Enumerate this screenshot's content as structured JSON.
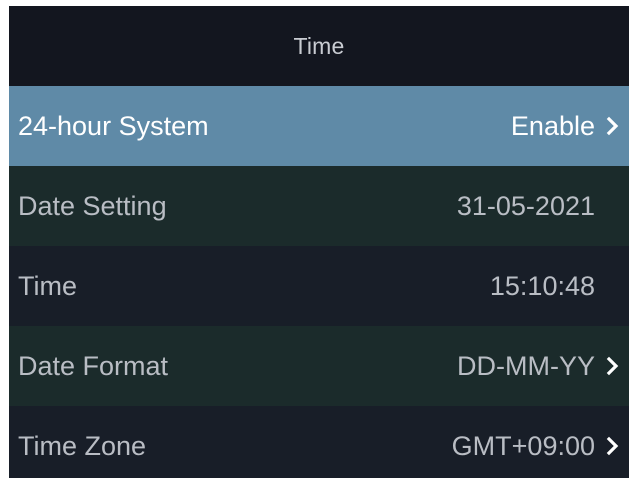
{
  "screen": {
    "title": "Time"
  },
  "rows": [
    {
      "label": "24-hour System",
      "value": "Enable",
      "has_arrow": true
    },
    {
      "label": "Date Setting",
      "value": "31-05-2021",
      "has_arrow": false
    },
    {
      "label": "Time",
      "value": "15:10:48",
      "has_arrow": false
    },
    {
      "label": "Date Format",
      "value": "DD-MM-YY",
      "has_arrow": true
    },
    {
      "label": "Time Zone",
      "value": "GMT+09:00",
      "has_arrow": true
    }
  ],
  "colors": {
    "background": "#13161f",
    "selected_row": "#5f8aa7",
    "row_dark": "#1b2b2b",
    "row_darker": "#181e28",
    "text": "#b9bdc4",
    "text_selected": "#ffffff"
  },
  "icons": {
    "arrow": "chevron-right-icon"
  }
}
